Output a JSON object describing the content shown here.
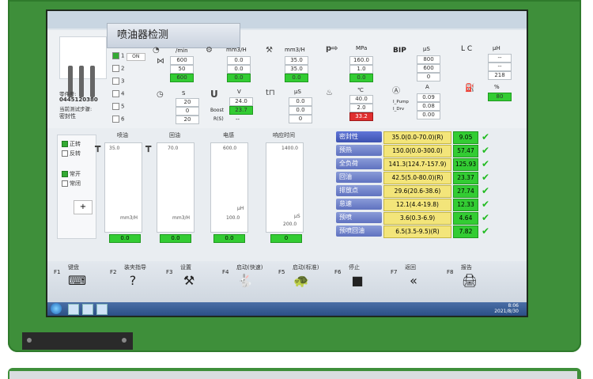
{
  "title": "喷油器检测",
  "injector_info": {
    "label1": "零件号:",
    "part": "0445120380",
    "label2": "当前测试步骤:",
    "step": "密封性"
  },
  "cylinders": [
    {
      "n": "1",
      "checked": true,
      "v": "ON"
    },
    {
      "n": "2",
      "checked": false,
      "v": ""
    },
    {
      "n": "3",
      "checked": false,
      "v": ""
    },
    {
      "n": "4",
      "checked": false,
      "v": ""
    },
    {
      "n": "5",
      "checked": false,
      "v": ""
    },
    {
      "n": "6",
      "checked": false,
      "v": ""
    }
  ],
  "g1": {
    "unit": "/min",
    "a": "600",
    "b": "50",
    "c": "600"
  },
  "g2": {
    "unit": "mm3/H",
    "a": "0.0",
    "b": "0.0",
    "c": "0.0"
  },
  "g3": {
    "unit": "mm3/H",
    "a": "35.0",
    "b": "35.0",
    "c": "0.0"
  },
  "g4": {
    "unit": "MPa",
    "a": "160.0",
    "b": "1.0",
    "c": "0.0"
  },
  "g5": {
    "bip": "BIP",
    "unit": "µS",
    "a": "800",
    "b": "600",
    "c": "0"
  },
  "g6": {
    "lc": "L C",
    "unit": "µH",
    "a": "--",
    "b": "--",
    "c": "218"
  },
  "g7": {
    "unit": "S",
    "a": "20",
    "b": "0",
    "c": "20"
  },
  "g8": {
    "unit": "V",
    "a": "24.0",
    "b": "23.7",
    "boost": "Boost",
    "r": "R(S)",
    "c": "--"
  },
  "g9": {
    "unit": "µS",
    "a": "0.0",
    "b": "0.0",
    "c": "0"
  },
  "g10": {
    "unit": "℃",
    "a": "40.0",
    "b": "2.0",
    "c": "33.2"
  },
  "g11": {
    "unit": "A",
    "pump": "I_Pump",
    "drv": "I_Drv",
    "a": "0.09",
    "b": "0.08",
    "c": "0.00"
  },
  "g12": {
    "unit": "%",
    "a": "80"
  },
  "mode": {
    "fwd": "正转",
    "rev": "反转",
    "open": "常开",
    "close": "常闭"
  },
  "columns": [
    {
      "head": "喷油",
      "top": "35.0",
      "bottom": "mm3/H",
      "value": "0.0"
    },
    {
      "head": "回油",
      "top": "70.0",
      "bottom": "mm3/H",
      "value": "0.0"
    },
    {
      "head": "电感",
      "top": "600.0",
      "bottom": "µH",
      "mid": "100.0",
      "value": "0.0"
    },
    {
      "head": "响应时间",
      "top": "1400.0",
      "bottom": "µS",
      "mid": "200.0",
      "value": "0"
    }
  ],
  "results": [
    {
      "label": "密封性",
      "range": "35.0(0.0-70.0)(R)",
      "value": "9.05",
      "mark": "✔"
    },
    {
      "label": "预热",
      "range": "150.0(0.0-300.0)",
      "value": "57.47",
      "mark": "✔"
    },
    {
      "label": "全负荷",
      "range": "141.3(124.7-157.9)",
      "value": "125.93",
      "mark": "✔"
    },
    {
      "label": "回油",
      "range": "42.5(5.0-80.0)(R)",
      "value": "23.37",
      "mark": "✔"
    },
    {
      "label": "排放点",
      "range": "29.6(20.6-38.6)",
      "value": "27.74",
      "mark": "✔"
    },
    {
      "label": "怠速",
      "range": "12.1(4.4-19.8)",
      "value": "12.33",
      "mark": "✔"
    },
    {
      "label": "预喷",
      "range": "3.6(0.3-6.9)",
      "value": "4.64",
      "mark": "✔"
    },
    {
      "label": "预喷回油",
      "range": "6.5(3.5-9.5)(R)",
      "value": "7.82",
      "mark": "✔"
    }
  ],
  "fkeys": [
    {
      "fn": "F1",
      "label": "键盘",
      "icon": "⌨"
    },
    {
      "fn": "F2",
      "label": "装夹指导",
      "icon": "?"
    },
    {
      "fn": "F3",
      "label": "设置",
      "icon": "⚒"
    },
    {
      "fn": "F4",
      "label": "启动(快速)",
      "icon": "🐇"
    },
    {
      "fn": "F5",
      "label": "启动(标准)",
      "icon": "🐢"
    },
    {
      "fn": "F6",
      "label": "停止",
      "icon": "■"
    },
    {
      "fn": "F7",
      "label": "返回",
      "icon": "«"
    },
    {
      "fn": "F8",
      "label": "报告",
      "icon": "🖨"
    }
  ],
  "clock": {
    "time": "8:06",
    "date": "2021/8/30"
  }
}
